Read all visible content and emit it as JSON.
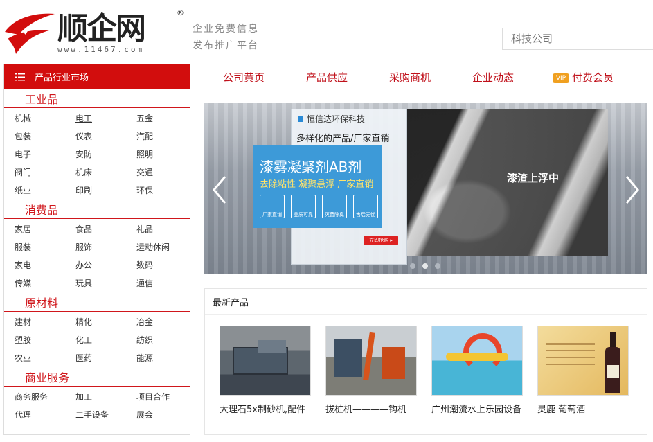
{
  "header": {
    "logo_text": "顺企网",
    "logo_url": "www.11467.com",
    "registered_mark": "®",
    "slogan_line1": "企业免费信息",
    "slogan_line2": "发布推广平台",
    "search_placeholder": "科技公司"
  },
  "sidebar": {
    "title": "产品行业市场",
    "categories": [
      {
        "title": "工业品",
        "items": [
          "机械",
          "电工",
          "五金",
          "包装",
          "仪表",
          "汽配",
          "电子",
          "安防",
          "照明",
          "阀门",
          "机床",
          "交通",
          "纸业",
          "印刷",
          "环保"
        ]
      },
      {
        "title": "消费品",
        "items": [
          "家居",
          "食品",
          "礼品",
          "服装",
          "服饰",
          "运动休闲",
          "家电",
          "办公",
          "数码",
          "传媒",
          "玩具",
          "通信"
        ]
      },
      {
        "title": "原材料",
        "items": [
          "建材",
          "精化",
          "冶金",
          "塑胶",
          "化工",
          "纺织",
          "农业",
          "医药",
          "能源"
        ]
      },
      {
        "title": "商业服务",
        "items": [
          "商务服务",
          "加工",
          "项目合作",
          "代理",
          "二手设备",
          "展会"
        ]
      }
    ]
  },
  "nav": {
    "items": [
      "公司黄页",
      "产品供应",
      "采购商机",
      "企业动态",
      "付费会员"
    ],
    "vip_badge": "VIP"
  },
  "banner": {
    "company": "恒信达环保科技",
    "tagline": "多样化的产品/厂家直销",
    "title": "漆雾凝聚剂AB剂",
    "subtitle": "去除粘性 凝聚悬浮 厂家直销",
    "features": [
      "厂家直销",
      "品质可靠",
      "灭菌除臭",
      "售后无忧"
    ],
    "buy_button": "立即抢购 ▸",
    "overlay_text": "漆渣上浮中",
    "slide_count": 3,
    "active_slide": 2
  },
  "latest": {
    "title": "最新产品",
    "products": [
      {
        "name": "大理石5x制砂机,配件"
      },
      {
        "name": "拔桩机————钩机"
      },
      {
        "name": "广州潮流水上乐园设备"
      },
      {
        "name": "灵鹿 葡萄酒"
      }
    ]
  },
  "colors": {
    "brand_red": "#d20d0d",
    "accent_red": "#c0101a",
    "banner_blue": "#3d9ad8"
  }
}
